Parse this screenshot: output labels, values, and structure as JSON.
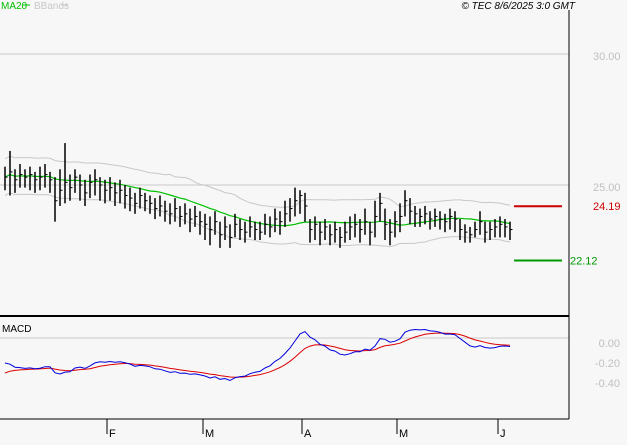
{
  "header": {
    "legend_ma": "MA20",
    "legend_bbands": "BBands",
    "copyright": "© TEC 8/6/2025 3:0 GMT"
  },
  "colors": {
    "ma": "#00c000",
    "bbands": "#c8c8c8",
    "resistance": "#cc0000",
    "support": "#009900",
    "macd": "#0000dd",
    "signal": "#dd0000",
    "bars": "#000000"
  },
  "chart_data": [
    {
      "type": "ohlc",
      "title": "Price",
      "y_ticks": [
        "30.00",
        "25.00"
      ],
      "y_tick_values": [
        30,
        25
      ],
      "x_tick_labels": [
        "F",
        "M",
        "A",
        "M",
        "J"
      ],
      "ylim": [
        20.1,
        32.1
      ],
      "levels": [
        {
          "name": "resistance",
          "value": 24.19,
          "label": "24.19"
        },
        {
          "name": "support",
          "value": 22.12,
          "label": "22.12"
        }
      ],
      "indicators": [
        "MA20",
        "BBands(20,2)"
      ],
      "close": [
        25.3,
        25.5,
        25.2,
        25.4,
        25.3,
        25.4,
        25.2,
        25.3,
        25.4,
        25.2,
        24.4,
        24.8,
        25.1,
        24.9,
        25.3,
        25.0,
        24.7,
        25.1,
        25.2,
        25.0,
        24.8,
        24.9,
        24.7,
        24.8,
        24.6,
        24.5,
        24.3,
        24.6,
        24.4,
        24.3,
        24.1,
        24.2,
        24.0,
        23.9,
        24.1,
        23.8,
        23.9,
        23.7,
        23.8,
        23.6,
        23.5,
        23.3,
        23.6,
        23.1,
        23.4,
        23.0,
        23.5,
        23.3,
        23.2,
        23.4,
        23.3,
        23.2,
        23.5,
        23.4,
        23.7,
        23.6,
        23.9,
        24.1,
        24.4,
        24.6,
        24.2,
        23.3,
        23.5,
        23.2,
        23.4,
        23.1,
        23.3,
        23.0,
        23.2,
        23.4,
        23.5,
        23.3,
        23.6,
        23.2,
        23.8,
        24.3,
        23.5,
        23.2,
        23.6,
        23.8,
        24.4,
        24.0,
        23.9,
        23.8,
        23.9,
        23.7,
        23.8,
        23.7,
        23.6,
        23.8,
        23.7,
        23.3,
        23.2,
        23.1,
        23.3,
        23.6,
        23.2,
        23.3,
        23.4,
        23.5,
        23.4,
        23.3
      ],
      "high": [
        25.7,
        26.3,
        25.6,
        25.8,
        25.6,
        25.7,
        25.5,
        25.7,
        25.8,
        25.5,
        25.3,
        25.6,
        26.6,
        25.4,
        25.6,
        25.4,
        25.2,
        25.4,
        25.6,
        25.3,
        25.2,
        25.3,
        25.1,
        25.2,
        25.0,
        24.9,
        24.7,
        24.9,
        24.7,
        24.6,
        24.5,
        24.6,
        24.4,
        24.3,
        24.5,
        24.2,
        24.3,
        24.1,
        24.2,
        24.0,
        23.9,
        23.8,
        24.0,
        23.6,
        23.8,
        23.5,
        23.9,
        23.7,
        23.6,
        23.8,
        23.6,
        23.6,
        23.9,
        23.8,
        24.1,
        24.0,
        24.4,
        24.5,
        24.9,
        24.8,
        24.7,
        23.7,
        23.8,
        23.6,
        23.7,
        23.5,
        23.6,
        23.4,
        23.6,
        23.8,
        23.9,
        23.7,
        24.1,
        23.6,
        24.4,
        24.7,
        24.1,
        23.7,
        24.0,
        24.3,
        24.8,
        24.5,
        24.2,
        24.1,
        24.2,
        24.0,
        24.1,
        24.0,
        23.9,
        24.1,
        24.0,
        23.7,
        23.5,
        23.4,
        23.6,
        24.0,
        23.6,
        23.6,
        23.7,
        23.8,
        23.7,
        23.6
      ],
      "low": [
        24.8,
        24.6,
        24.7,
        24.9,
        24.9,
        24.8,
        24.7,
        24.8,
        24.9,
        24.7,
        23.6,
        24.2,
        24.3,
        24.4,
        24.7,
        24.4,
        24.2,
        24.5,
        24.6,
        24.4,
        24.3,
        24.4,
        24.2,
        24.3,
        24.1,
        24.0,
        23.9,
        24.1,
        24.0,
        23.9,
        23.7,
        23.8,
        23.6,
        23.5,
        23.6,
        23.4,
        23.5,
        23.2,
        23.4,
        23.1,
        22.9,
        22.7,
        23.1,
        22.6,
        22.9,
        22.6,
        23.0,
        22.9,
        22.8,
        23.0,
        22.9,
        22.9,
        23.1,
        23.0,
        23.2,
        23.1,
        23.4,
        23.6,
        23.8,
        23.9,
        23.6,
        22.8,
        22.9,
        22.7,
        22.9,
        22.7,
        22.8,
        22.6,
        22.8,
        22.9,
        23.0,
        22.8,
        23.1,
        22.7,
        23.0,
        23.6,
        22.9,
        22.7,
        23.0,
        23.2,
        23.8,
        23.5,
        23.4,
        23.4,
        23.5,
        23.3,
        23.4,
        23.3,
        23.2,
        23.3,
        23.2,
        22.9,
        22.8,
        22.8,
        23.0,
        23.1,
        22.8,
        22.9,
        23.0,
        23.0,
        23.0,
        22.9
      ]
    },
    {
      "type": "line",
      "title": "MACD",
      "series": [
        {
          "name": "MACD"
        },
        {
          "name": "Signal"
        }
      ],
      "y_ticks": [
        "0.00",
        "-0.20",
        "-0.40"
      ],
      "y_tick_values": [
        0,
        -0.2,
        -0.4
      ],
      "ylim": [
        -0.75,
        0.22
      ]
    }
  ]
}
